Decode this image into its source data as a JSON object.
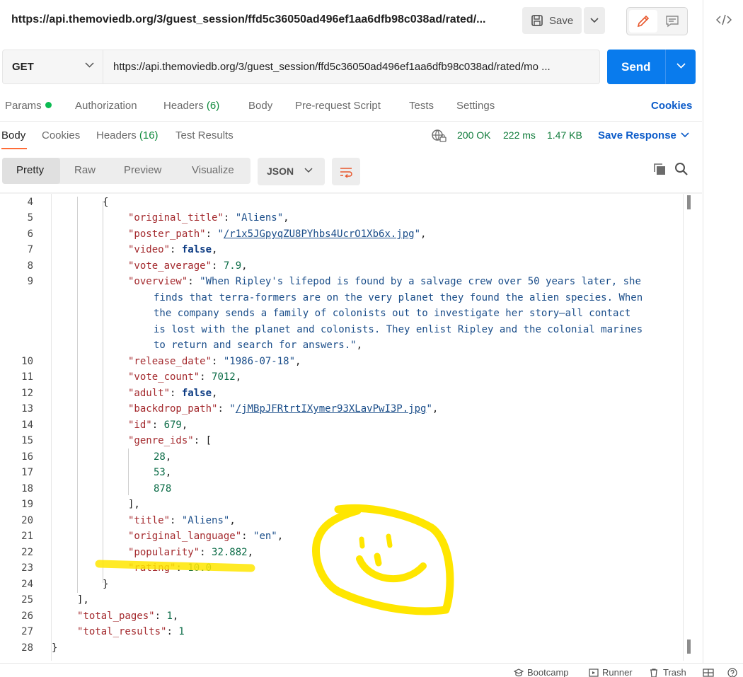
{
  "request": {
    "title": "https://api.themoviedb.org/3/guest_session/ffd5c36050ad496ef1aa6dfb98c038ad/rated/...",
    "save_label": "Save",
    "method": "GET",
    "url": "https://api.themoviedb.org/3/guest_session/ffd5c36050ad496ef1aa6dfb98c038ad/rated/mo ...",
    "send_label": "Send"
  },
  "request_tabs": {
    "params": "Params",
    "authorization": "Authorization",
    "headers": "Headers",
    "headers_count": "(6)",
    "body": "Body",
    "prerequest": "Pre-request Script",
    "tests": "Tests",
    "settings": "Settings",
    "cookies": "Cookies"
  },
  "response_tabs": {
    "body": "Body",
    "cookies": "Cookies",
    "headers": "Headers",
    "headers_count": "(16)",
    "test_results": "Test Results",
    "status": "200 OK",
    "time": "222 ms",
    "size": "1.47 KB",
    "save_response": "Save Response"
  },
  "format_bar": {
    "pretty": "Pretty",
    "raw": "Raw",
    "preview": "Preview",
    "visualize": "Visualize",
    "format": "JSON"
  },
  "code": {
    "line_numbers": [
      "4",
      "5",
      "6",
      "7",
      "8",
      "9",
      "10",
      "11",
      "12",
      "13",
      "14",
      "15",
      "16",
      "17",
      "18",
      "19",
      "20",
      "21",
      "22",
      "23",
      "24",
      "25",
      "26",
      "27",
      "28"
    ],
    "brace_open": "{",
    "k_original_title": "\"original_title\"",
    "v_original_title": "\"Aliens\"",
    "k_poster_path": "\"poster_path\"",
    "v_poster_path": "/r1x5JGpyqZU8PYhbs4UcrO1Xb6x.jpg",
    "k_video": "\"video\"",
    "v_video": "false",
    "k_vote_average": "\"vote_average\"",
    "v_vote_average": "7.9",
    "k_overview": "\"overview\"",
    "v_overview_1": "\"When Ripley's lifepod is found by a salvage crew over 50 years later, she",
    "v_overview_2": "finds that terra-formers are on the very planet they found the alien species. When",
    "v_overview_3": "the company sends a family of colonists out to investigate her story—all contact",
    "v_overview_4": "is lost with the planet and colonists. They enlist Ripley and the colonial marines",
    "v_overview_5": "to return and search for answers.\"",
    "k_release_date": "\"release_date\"",
    "v_release_date": "\"1986-07-18\"",
    "k_vote_count": "\"vote_count\"",
    "v_vote_count": "7012",
    "k_adult": "\"adult\"",
    "v_adult": "false",
    "k_backdrop_path": "\"backdrop_path\"",
    "v_backdrop_path": "/jMBpJFRtrtIXymer93XLavPwI3P.jpg",
    "k_id": "\"id\"",
    "v_id": "679",
    "k_genre_ids": "\"genre_ids\"",
    "v_genre_1": "28",
    "v_genre_2": "53",
    "v_genre_3": "878",
    "k_title": "\"title\"",
    "v_title": "\"Aliens\"",
    "k_original_language": "\"original_language\"",
    "v_original_language": "\"en\"",
    "k_popularity": "\"popularity\"",
    "v_popularity": "32.882",
    "k_rating": "\"rating\"",
    "v_rating": "10.0",
    "brace_close": "}",
    "array_close": "],",
    "k_total_pages": "\"total_pages\"",
    "v_total_pages": "1",
    "k_total_results": "\"total_results\"",
    "v_total_results": "1",
    "root_close": "}"
  },
  "statusbar": {
    "bootcamp": "Bootcamp",
    "runner": "Runner",
    "trash": "Trash"
  },
  "colors": {
    "accent_orange": "#ff6c37",
    "send_blue": "#097bed",
    "link_blue": "#0b5bc9",
    "status_green": "#0f7b3a",
    "highlighter_yellow": "#ffe600"
  }
}
